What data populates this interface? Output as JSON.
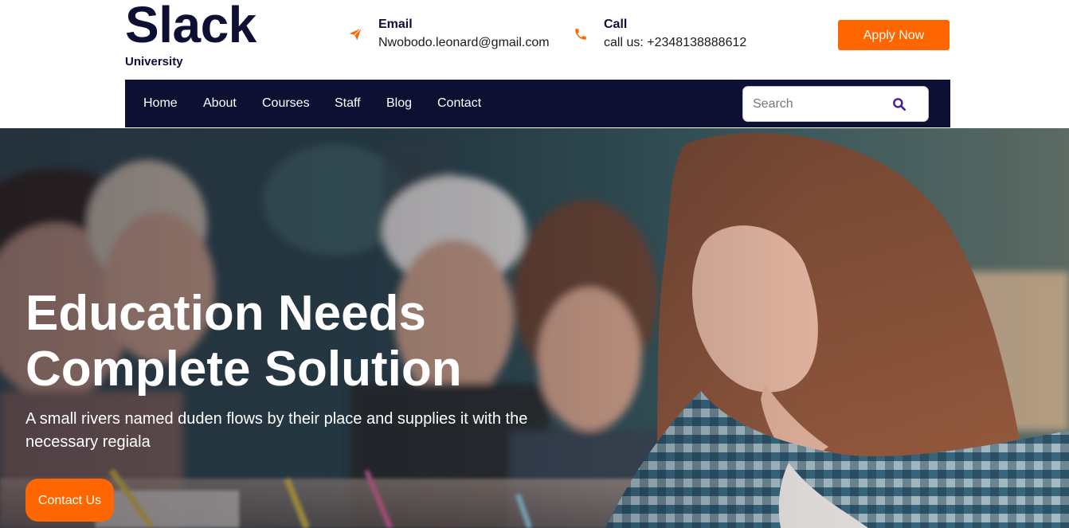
{
  "brand": {
    "name": "Slack",
    "subtitle": "University"
  },
  "contact": {
    "email": {
      "icon": "paper-plane-icon",
      "title": "Email",
      "value": "Nwobodo.leonard@gmail.com"
    },
    "call": {
      "icon": "phone-icon",
      "title": "Call",
      "value": "call us: +2348138888612"
    }
  },
  "header": {
    "apply_label": "Apply Now"
  },
  "nav": {
    "items": [
      {
        "label": "Home"
      },
      {
        "label": "About"
      },
      {
        "label": "Courses"
      },
      {
        "label": "Staff"
      },
      {
        "label": "Blog"
      },
      {
        "label": "Contact"
      }
    ]
  },
  "search": {
    "placeholder": "Search",
    "value": "",
    "icon": "search-icon"
  },
  "hero": {
    "title_line1": "Education Needs",
    "title_line2": "Complete Solution",
    "description": "A small rivers named duden flows by their place and supplies it with the necessary regiala",
    "cta_label": "Contact Us"
  },
  "colors": {
    "brand_dark": "#0d1033",
    "accent": "#ff6600",
    "search_icon": "#4b1fa0"
  }
}
